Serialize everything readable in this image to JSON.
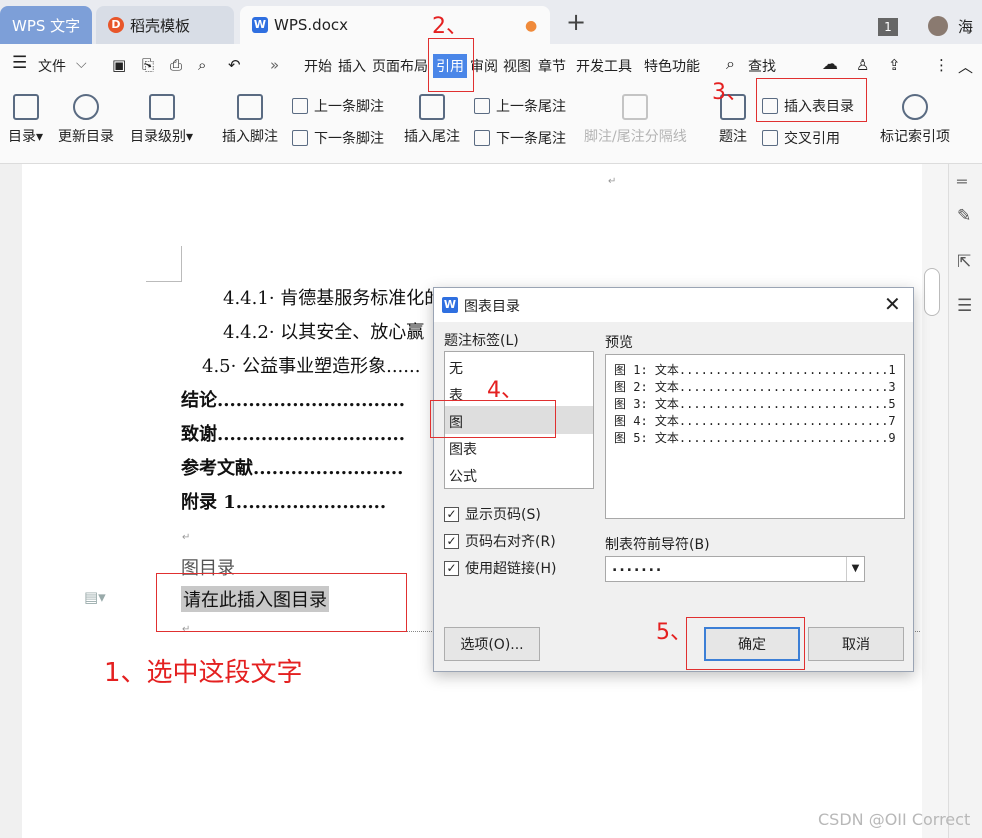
{
  "tabs": [
    {
      "label": "WPS 文字"
    },
    {
      "label": "稻壳模板"
    },
    {
      "label": "WPS.docx"
    }
  ],
  "tabbar": {
    "badge": "1",
    "user": "海"
  },
  "menu": {
    "file": "文件",
    "items": [
      "开始",
      "插入",
      "页面布局",
      "引用",
      "审阅",
      "视图",
      "章节",
      "开发工具",
      "特色功能"
    ],
    "search": "查找"
  },
  "ribbon": {
    "toc": "目录",
    "update_toc": "更新目录",
    "toc_level": "目录级别",
    "insert_footnote": "插入脚注",
    "prev_footnote": "上一条脚注",
    "next_footnote": "下一条脚注",
    "insert_endnote": "插入尾注",
    "prev_endnote": "上一条尾注",
    "next_endnote": "下一条尾注",
    "separator": "脚注/尾注分隔线",
    "caption": "题注",
    "insert_table_toc": "插入表目录",
    "cross_ref": "交叉引用",
    "mark_index": "标记索引项"
  },
  "document": {
    "lines": [
      {
        "num": "4.4.1",
        "text": "肯德基服务标准化的关键点"
      },
      {
        "num": "4.4.2",
        "text": "以其安全、放心赢"
      },
      {
        "num": "4.5",
        "text": "公益事业塑造形象......"
      },
      {
        "text": "结论.............................."
      },
      {
        "text": "致谢.............................."
      },
      {
        "text": "参考文献........................"
      },
      {
        "text": "附录 1........................"
      }
    ],
    "fig_toc_title": "图目录",
    "placeholder": "请在此插入图目录"
  },
  "annotations": {
    "step1": "1、选中这段文字",
    "step2": "2、",
    "step3": "3、",
    "step4": "4、",
    "step5": "5、"
  },
  "dialog": {
    "title": "图表目录",
    "caption_label": "题注标签(L)",
    "caption_options": [
      "无",
      "表",
      "图",
      "图表",
      "公式"
    ],
    "selected": "图",
    "preview_label": "预览",
    "preview_lines": [
      "图 1: 文本.............................1",
      "图 2: 文本.............................3",
      "图 3: 文本.............................5",
      "图 4: 文本.............................7",
      "图 5: 文本.............................9"
    ],
    "show_page": "显示页码(S)",
    "right_align": "页码右对齐(R)",
    "hyperlink": "使用超链接(H)",
    "leader_label": "制表符前导符(B)",
    "leader_value": ".......",
    "options_btn": "选项(O)...",
    "ok_btn": "确定",
    "cancel_btn": "取消"
  },
  "watermark": "CSDN @OII Correct",
  "colors": {
    "accent": "#4a86e8",
    "annotation": "#e42020"
  }
}
